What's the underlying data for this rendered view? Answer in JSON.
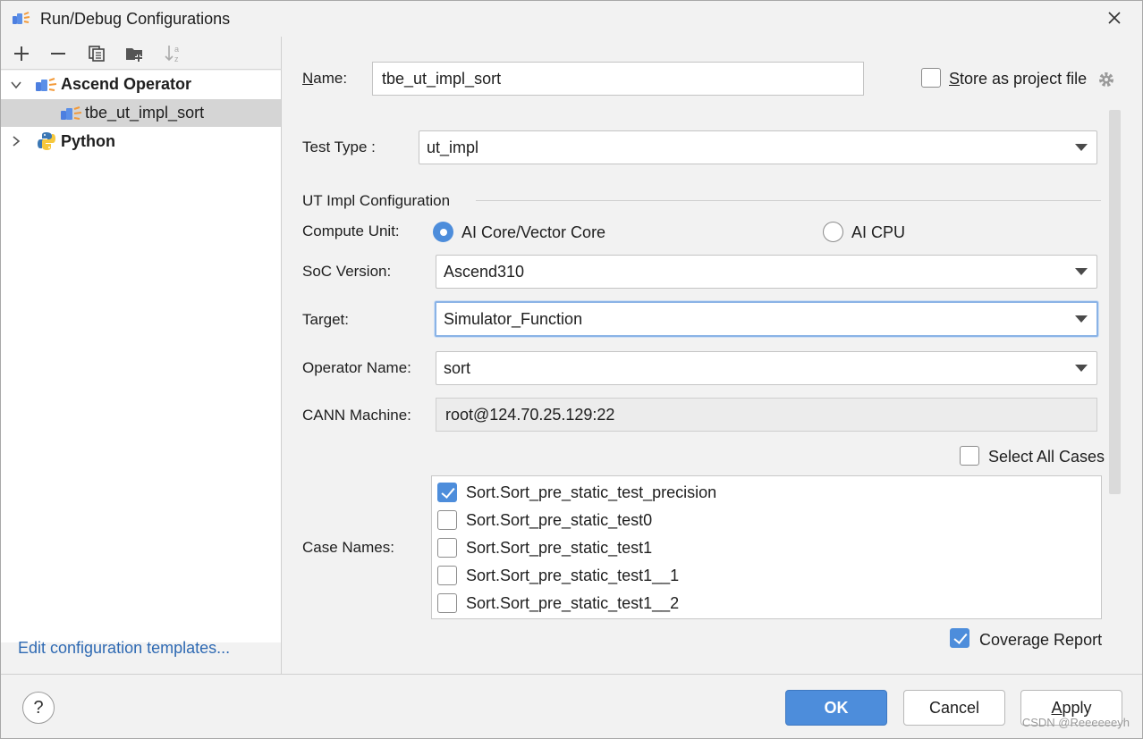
{
  "window": {
    "title": "Run/Debug Configurations",
    "close_icon": "close-icon"
  },
  "toolbar": {
    "icons": [
      "add-icon",
      "remove-icon",
      "copy-icon",
      "new-folder-icon",
      "sort-icon"
    ]
  },
  "tree": {
    "groups": [
      {
        "label": "Ascend Operator",
        "expanded": true,
        "icon": "ascend-operator-icon"
      },
      {
        "label": "Python",
        "expanded": false,
        "icon": "python-icon"
      }
    ],
    "children": [
      {
        "label": "tbe_ut_impl_sort",
        "selected": true,
        "icon": "ascend-operator-icon"
      }
    ]
  },
  "edit_templates_link": "Edit configuration templates...",
  "form": {
    "name_label_u": "N",
    "name_label_rest": "ame:",
    "name_value": "tbe_ut_impl_sort",
    "store_label_u": "S",
    "store_label_rest": "tore as project file",
    "store_checked": false,
    "test_type_label": "Test Type :",
    "test_type_value": "ut_impl",
    "section_title": "UT Impl Configuration",
    "compute_unit_label": "Compute Unit:",
    "compute_unit_options": [
      "AI Core/Vector Core",
      "AI CPU"
    ],
    "compute_unit_selected": "AI Core/Vector Core",
    "soc_version_label": "SoC Version:",
    "soc_version_value": "Ascend310",
    "target_label": "Target:",
    "target_value": "Simulator_Function",
    "operator_name_label": "Operator Name:",
    "operator_name_value": "sort",
    "cann_machine_label": "CANN Machine:",
    "cann_machine_value": "root@124.70.25.129:22",
    "select_all_label": "Select All Cases",
    "select_all_checked": false,
    "case_names_label": "Case Names:",
    "cases": [
      {
        "name": "Sort.Sort_pre_static_test_precision",
        "checked": true
      },
      {
        "name": "Sort.Sort_pre_static_test0",
        "checked": false
      },
      {
        "name": "Sort.Sort_pre_static_test1",
        "checked": false
      },
      {
        "name": "Sort.Sort_pre_static_test1__1",
        "checked": false
      },
      {
        "name": "Sort.Sort_pre_static_test1__2",
        "checked": false
      }
    ],
    "coverage_label": "Coverage Report",
    "coverage_checked": true
  },
  "footer": {
    "help_label": "?",
    "ok_label": "OK",
    "cancel_label": "Cancel",
    "apply_label_u": "A",
    "apply_label_rest": "pply",
    "watermark": "CSDN @Reeeeeeyh"
  },
  "colors": {
    "accent": "#4d8ddb",
    "link": "#2f6ab3",
    "background": "#f2f2f2"
  }
}
